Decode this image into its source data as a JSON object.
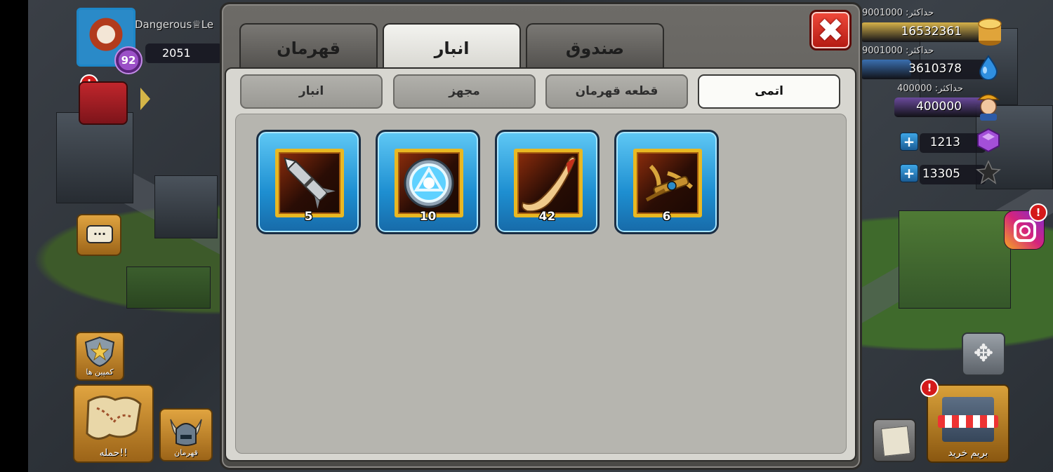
{
  "player": {
    "name": "Dangerous♕Le",
    "level": "92",
    "trophies": "2051",
    "gift_alert": "!"
  },
  "resources": {
    "gold": {
      "cap_label": "حداکثر: 9001000",
      "value": "16532361",
      "fill_fraction": 1.0,
      "icon": "gold-coin-icon",
      "color": "#d6b24a"
    },
    "elixir": {
      "cap_label": "حداکثر: 9001000",
      "value": "3610378",
      "fill_fraction": 0.4,
      "icon": "blue-drop-icon",
      "color": "#3a6fb0"
    },
    "workers": {
      "cap_label": "حداکثر: 400000",
      "value": "400000",
      "fill_fraction": 1.0,
      "icon": "worker-face-icon",
      "color": "#6a4a9c"
    },
    "gems": {
      "value": "1213",
      "icon": "purple-gem-icon",
      "color": "#9b4fc7"
    },
    "shards": {
      "value": "13305",
      "icon": "dark-star-icon",
      "color": "#2a2a2a"
    }
  },
  "social": {
    "instagram_alert": "!"
  },
  "left_buttons": {
    "chat_text": "...",
    "shield_label": "کمپین ها",
    "attack_label": "حمله!!",
    "hero_label": "قهرمان"
  },
  "right_buttons": {
    "shop_label": "بریم خرید",
    "shop_alert": "!"
  },
  "modal": {
    "close_symbol": "✖",
    "main_tabs": [
      {
        "label": "صندوق",
        "active": false
      },
      {
        "label": "انبار",
        "active": true
      },
      {
        "label": "قهرمان",
        "active": false
      }
    ],
    "sub_tabs": [
      {
        "label": "اتمی",
        "active": true
      },
      {
        "label": "قطعه قهرمان",
        "active": false
      },
      {
        "label": "مجهز",
        "active": false
      },
      {
        "label": "انبار",
        "active": false
      }
    ],
    "items": [
      {
        "icon": "missile-icon",
        "quantity": "5"
      },
      {
        "icon": "arc-reactor-icon",
        "quantity": "10"
      },
      {
        "icon": "horn-icon",
        "quantity": "42"
      },
      {
        "icon": "golden-crossbow-icon",
        "quantity": "6"
      }
    ]
  }
}
